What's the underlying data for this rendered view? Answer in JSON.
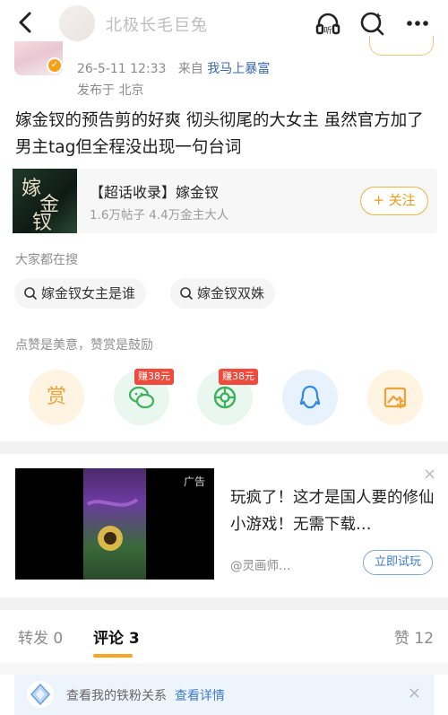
{
  "header": {
    "title": "北极长毛巨兔"
  },
  "post": {
    "date": "26-5-11 12:33",
    "from_label": "来自",
    "source": "我马上暴富",
    "location": "发布于 北京",
    "text": "嫁金钗的预告剪的好爽 彻头彻尾的大女主 虽然官方加了男主tag但全程没出现一句台词"
  },
  "topic": {
    "thumb_text": [
      "嫁",
      "金",
      "钗"
    ],
    "title": "【超话收录】嫁金钗",
    "stats": "1.6万帖子  4.4万金主大人",
    "follow_label": "+ 关注"
  },
  "search": {
    "label": "大家都在搜",
    "chips": [
      "嫁金钗女主是谁",
      "嫁金钗双姝"
    ]
  },
  "share": {
    "label": "点赞是美意，赞赏是鼓励",
    "reward_label": "赏",
    "earn_badges": [
      "赚38元",
      "赚38元"
    ],
    "icons": [
      "reward-icon",
      "wechat-icon",
      "moments-icon",
      "qq-icon",
      "save-image-icon"
    ]
  },
  "ad": {
    "tag": "广告",
    "text": "玩疯了！这才是国人要的修仙小游戏！无需下载…",
    "source": "@灵画师…",
    "button": "立即试玩",
    "close": "×"
  },
  "tabs": {
    "repost": "转发 0",
    "comment": "评论 3",
    "like": "赞 12"
  },
  "fan_bar": {
    "text": "查看我的铁粉关系",
    "link": "查看详情",
    "close": "×"
  },
  "colors": {
    "accent": "#f5a623",
    "link": "#3b6aa8",
    "earn_badge": "#ef4a3c"
  }
}
